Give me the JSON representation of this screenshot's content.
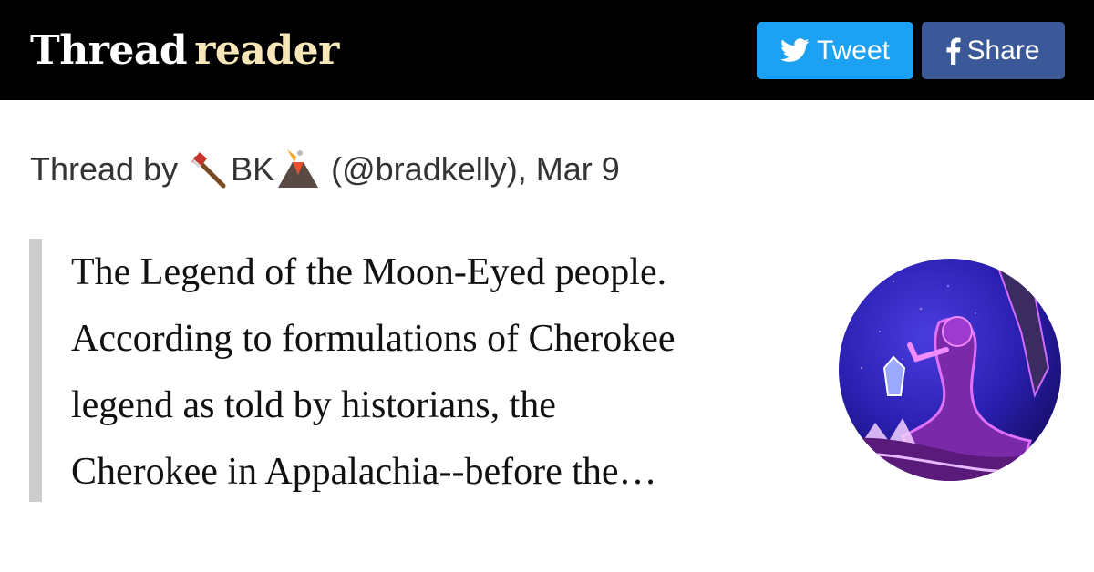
{
  "header": {
    "logo_thread": "Thread",
    "logo_reader": "reader",
    "tweet_label": "Tweet",
    "share_label": "Share"
  },
  "byline": {
    "prefix": "Thread by",
    "name": "BK",
    "handle_date": "(@bradkelly), Mar 9",
    "emoji_before": "axe-icon",
    "emoji_after": "volcano-icon"
  },
  "tweet": {
    "lines": [
      "The Legend of the Moon-Eyed people.",
      "According to formulations of Cherokee",
      "legend as told by historians, the",
      "Cherokee in Appalachia--before the…"
    ]
  },
  "colors": {
    "header_bg": "#000000",
    "logo_reader": "#f7e6b8",
    "tweet_button": "#1da1f2",
    "share_button": "#3b5998",
    "quote_bar": "#cccccc"
  },
  "avatar": {
    "icon": "profile-avatar"
  }
}
